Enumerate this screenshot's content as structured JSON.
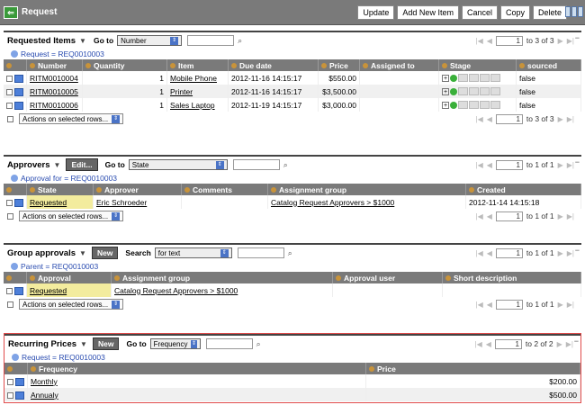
{
  "topbar": {
    "title": "Request",
    "buttons": [
      "Update",
      "Add New Item",
      "Cancel",
      "Copy",
      "Delete"
    ]
  },
  "requested_items": {
    "title": "Requested Items",
    "goto_label": "Go to",
    "goto_select": "Number",
    "filter": "Request = REQ0010003",
    "pager": {
      "page": "1",
      "range": "to 3 of 3"
    },
    "columns": [
      "Number",
      "Quantity",
      "Item",
      "Due date",
      "Price",
      "Assigned to",
      "Stage",
      "sourced"
    ],
    "rows": [
      {
        "number": "RITM0010004",
        "quantity": "1",
        "item": "Mobile Phone",
        "due": "2012-11-16 14:15:17",
        "price": "$550.00",
        "assigned": "",
        "sourced": "false"
      },
      {
        "number": "RITM0010005",
        "quantity": "1",
        "item": "Printer",
        "due": "2012-11-16 14:15:17",
        "price": "$3,500.00",
        "assigned": "",
        "sourced": "false"
      },
      {
        "number": "RITM0010006",
        "quantity": "1",
        "item": "Sales Laptop",
        "due": "2012-11-19 14:15:17",
        "price": "$3,000.00",
        "assigned": "",
        "sourced": "false"
      }
    ],
    "actions": "Actions on selected rows..."
  },
  "approvers": {
    "title": "Approvers",
    "edit_label": "Edit...",
    "goto_label": "Go to",
    "goto_select": "State",
    "filter": "Approval for = REQ0010003",
    "pager": {
      "page": "1",
      "range": "to 1 of 1"
    },
    "columns": [
      "State",
      "Approver",
      "Comments",
      "Assignment group",
      "Created"
    ],
    "rows": [
      {
        "state": "Requested",
        "approver": "Eric Schroeder",
        "comments": "",
        "group": "Catalog Request Approvers > $1000",
        "created": "2012-11-14 14:15:18"
      }
    ],
    "actions": "Actions on selected rows..."
  },
  "group_approvals": {
    "title": "Group approvals",
    "new_label": "New",
    "search_label": "Search",
    "search_select": "for text",
    "filter": "Parent = REQ0010003",
    "pager": {
      "page": "1",
      "range": "to 1 of 1"
    },
    "columns": [
      "Approval",
      "Assignment group",
      "Approval user",
      "Short description"
    ],
    "rows": [
      {
        "approval": "Requested",
        "group": "Catalog Request Approvers > $1000",
        "user": "",
        "desc": ""
      }
    ],
    "actions": "Actions on selected rows..."
  },
  "recurring": {
    "title": "Recurring Prices",
    "new_label": "New",
    "goto_label": "Go to",
    "goto_select": "Frequency",
    "filter": "Request = REQ0010003",
    "pager": {
      "page": "1",
      "range": "to 2 of 2"
    },
    "columns": [
      "Frequency",
      "Price"
    ],
    "rows": [
      {
        "frequency": "Monthly",
        "price": "$200.00"
      },
      {
        "frequency": "Annualy",
        "price": "$500.00"
      }
    ]
  }
}
